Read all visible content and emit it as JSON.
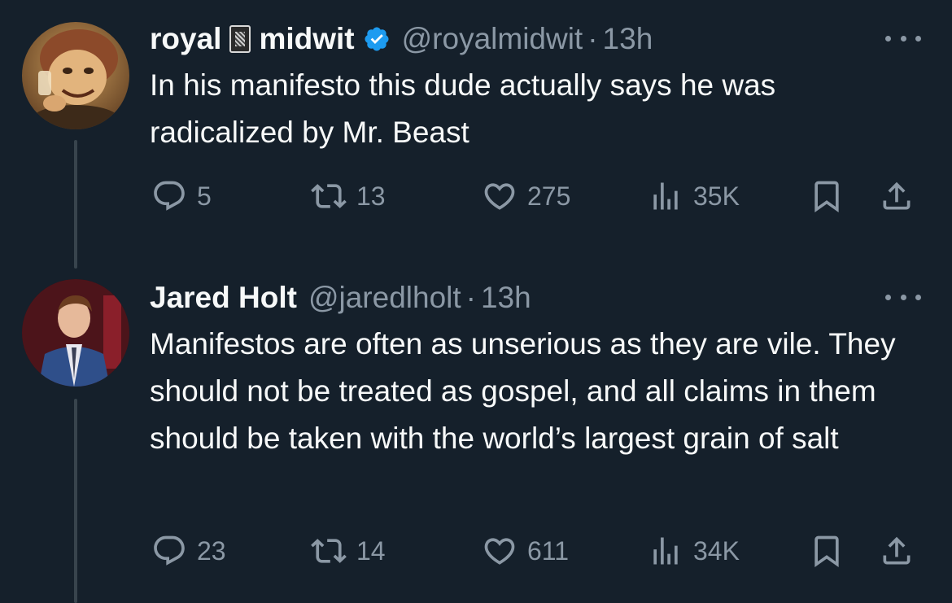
{
  "tweets": [
    {
      "name_part1": "royal",
      "name_part2": "midwit",
      "verified": true,
      "handle": "@royalmidwit",
      "separator": "·",
      "time": "13h",
      "text": "In his manifesto this dude actually says he was radicalized by Mr. Beast",
      "replies": "5",
      "retweets": "13",
      "likes": "275",
      "views": "35K"
    },
    {
      "name": "Jared Holt",
      "handle": "@jaredlholt",
      "separator": "·",
      "time": "13h",
      "text": "Manifestos are often as unserious as they are vile. They should not be treated as gospel, and all claims in them should be taken with the world’s largest grain of salt",
      "replies": "23",
      "retweets": "14",
      "likes": "611",
      "views": "34K"
    }
  ],
  "colors": {
    "background": "#15202b",
    "text_primary": "#f7f9f9",
    "text_secondary": "#8b98a5",
    "verified_blue": "#1d9bf0",
    "thread_line": "#38444d"
  },
  "icons": {
    "reply": "speech-bubble",
    "retweet": "retweet-arrows",
    "like": "heart",
    "views": "bar-chart",
    "bookmark": "bookmark",
    "share": "upload-arrow",
    "more": "three-dots",
    "verified": "verified-badge",
    "name_emoji": "playing-card"
  }
}
